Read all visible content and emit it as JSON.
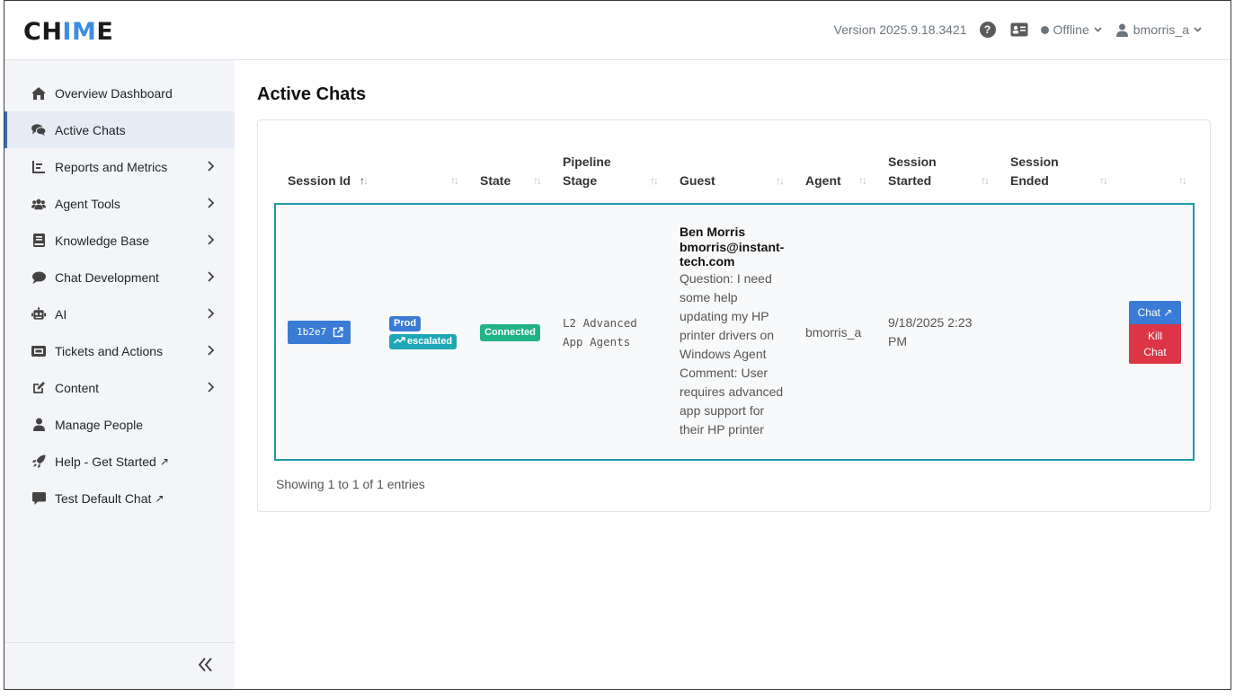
{
  "app": {
    "logo_pre": "CH",
    "logo_accent": "IM",
    "logo_post": "E",
    "accent_color": "#3c8de0"
  },
  "header": {
    "version": "Version 2025.9.18.3421",
    "help_icon": "question-circle-icon",
    "card_icon": "id-card-icon",
    "status": "Offline",
    "username": "bmorris_a"
  },
  "sidebar": {
    "items": [
      {
        "label": "Overview Dashboard",
        "icon": "home-icon"
      },
      {
        "label": "Active Chats",
        "icon": "comments-icon",
        "active": true
      },
      {
        "label": "Reports and Metrics",
        "icon": "chart-icon"
      },
      {
        "label": "Agent Tools",
        "icon": "users-icon"
      },
      {
        "label": "Knowledge Base",
        "icon": "book-icon"
      },
      {
        "label": "Chat Development",
        "icon": "comment-icon"
      },
      {
        "label": "AI",
        "icon": "robot-icon"
      },
      {
        "label": "Tickets and Actions",
        "icon": "ticket-icon"
      },
      {
        "label": "Content",
        "icon": "edit-icon"
      },
      {
        "label": "Manage People",
        "icon": "user-icon"
      },
      {
        "label": "Help - Get Started",
        "icon": "rocket-icon"
      },
      {
        "label": "Test Default Chat",
        "icon": "message-icon"
      }
    ],
    "external_mark": "↗",
    "collapse_icon": "double-chevron-left-icon"
  },
  "main": {
    "title": "Active Chats",
    "columns": {
      "session_id": "Session Id",
      "state": "State",
      "pipeline_1": "Pipeline",
      "pipeline_2": "Stage",
      "guest": "Guest",
      "agent": "Agent",
      "started_1": "Session",
      "started_2": "Started",
      "ended_1": "Session",
      "ended_2": "Ended"
    },
    "row": {
      "session_id": "1b2e7",
      "badge_prod": "Prod",
      "badge_escalated": "escalated",
      "state": "Connected",
      "pipeline_1": "L2 Advanced",
      "pipeline_2": "App Agents",
      "guest_name": "Ben Morris",
      "guest_email": "bmorris@instant-tech.com",
      "guest_details": "Question: I need some help updating my HP printer drivers on Windows Agent Comment: User requires advanced app support for their HP printer",
      "agent": "bmorris_a",
      "started": "9/18/2025 2:23 PM",
      "ended": "",
      "chat_button": "Chat ↗",
      "kill_button": "Kill Chat"
    },
    "showing": "Showing 1 to 1 of 1 entries"
  },
  "colors": {
    "primary": "#3a7bd5",
    "danger": "#dc3545",
    "success": "#20b387",
    "info": "#1ea7b4",
    "row_outline": "#1f9aa8"
  }
}
